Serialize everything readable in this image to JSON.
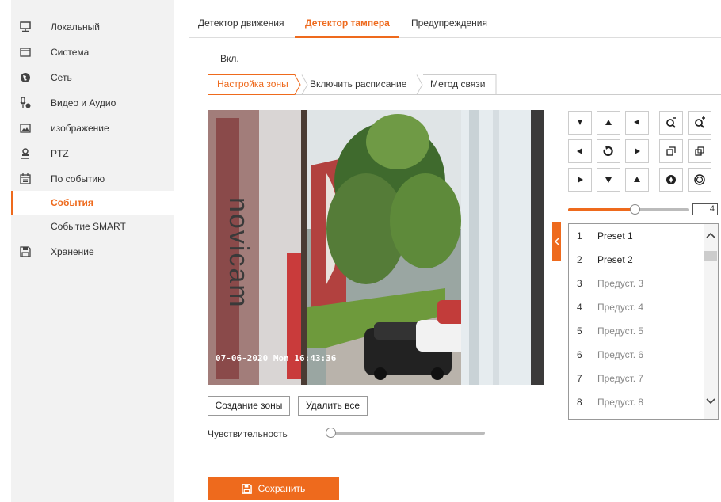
{
  "sidebar": {
    "items": [
      {
        "label": "Локальный",
        "icon": "monitor-icon"
      },
      {
        "label": "Система",
        "icon": "system-window-icon"
      },
      {
        "label": "Сеть",
        "icon": "globe-icon"
      },
      {
        "label": "Видео и Аудио",
        "icon": "video-audio-icon"
      },
      {
        "label": "изображение",
        "icon": "image-icon"
      },
      {
        "label": "PTZ",
        "icon": "ptz-user-icon"
      },
      {
        "label": "По событию",
        "icon": "calendar-icon"
      },
      {
        "label": "События"
      },
      {
        "label": "Событие SMART"
      },
      {
        "label": "Хранение",
        "icon": "storage-icon"
      }
    ],
    "active_index": 7
  },
  "tabs": [
    {
      "label": "Детектор движения"
    },
    {
      "label": "Детектор тампера"
    },
    {
      "label": "Предупреждения"
    }
  ],
  "active_tab": 1,
  "enable_checkbox": {
    "label": "Вкл.",
    "checked": false
  },
  "steps": [
    {
      "label": "Настройка зоны"
    },
    {
      "label": "Включить расписание"
    },
    {
      "label": "Метод связи"
    }
  ],
  "video": {
    "osd_timestamp": "07-06-2020 Mon 16:43:36",
    "watermark": "novicam"
  },
  "buttons": {
    "create_zone": "Создание зоны",
    "delete_all": "Удалить все"
  },
  "sensitivity": {
    "label": "Чувствительность",
    "value": 0
  },
  "save_label": "Сохранить",
  "ptz": {
    "speed": {
      "value": "4",
      "fraction": 0.55
    },
    "pad": [
      "up-left-arrow-icon",
      "up-arrow-icon",
      "up-right-arrow-icon",
      "left-arrow-icon",
      "auto-rotate-icon",
      "right-arrow-icon",
      "down-left-arrow-icon",
      "down-arrow-icon",
      "down-right-arrow-icon"
    ],
    "lens": [
      "zoom-out-icon",
      "zoom-in-icon",
      "focus-near-icon",
      "focus-far-icon",
      "iris-close-icon",
      "iris-open-icon"
    ],
    "presets": [
      {
        "num": "1",
        "name": "Preset 1",
        "active": true
      },
      {
        "num": "2",
        "name": "Preset 2",
        "active": true
      },
      {
        "num": "3",
        "name": "Предуст. 3",
        "active": false
      },
      {
        "num": "4",
        "name": "Предуст. 4",
        "active": false
      },
      {
        "num": "5",
        "name": "Предуст. 5",
        "active": false
      },
      {
        "num": "6",
        "name": "Предуст. 6",
        "active": false
      },
      {
        "num": "7",
        "name": "Предуст. 7",
        "active": false
      },
      {
        "num": "8",
        "name": "Предуст. 8",
        "active": false
      }
    ]
  },
  "colors": {
    "accent": "#ee6a1d",
    "sidebar_bg": "#f2f2f2",
    "inactive_preset": "#888888"
  }
}
